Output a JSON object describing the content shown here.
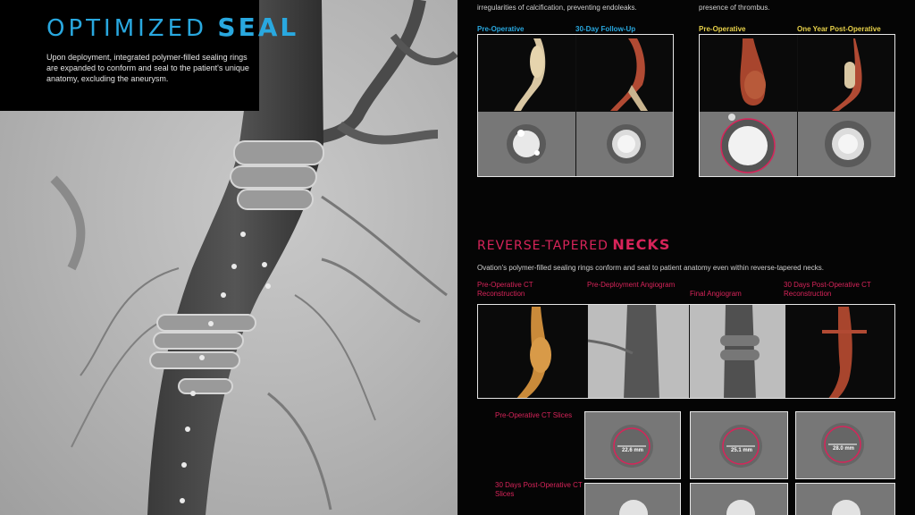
{
  "left_panel": {
    "title_thin": "OPTIMIZED",
    "title_bold": "SEAL",
    "description": "Upon deployment, integrated polymer-filled sealing rings are expanded to conform and seal to the patient's unique anatomy, excluding the aneurysm."
  },
  "top_section": {
    "left_note": "irregularities of calcification, preventing endoleaks.",
    "right_note": "presence of thrombus.",
    "case1": {
      "label_pre": "Pre-Operative",
      "label_post": "30-Day Follow-Up"
    },
    "case2": {
      "label_pre": "Pre-Operative",
      "label_post": "One Year Post-Operative"
    }
  },
  "reverse_section": {
    "title_thin": "REVERSE-TAPERED",
    "title_bold": "NECKS",
    "description": "Ovation's polymer-filled sealing rings conform and seal to patient anatomy even within reverse-tapered necks.",
    "labels": {
      "pre_ct": "Pre-Operative CT Reconstruction",
      "pre_angio": "Pre-Deployment Angiogram",
      "final_angio": "Final Angiogram",
      "post_ct": "30 Days Post-Operative CT Reconstruction"
    },
    "slices_pre_label": "Pre-Operative CT Slices",
    "slices_post_label": "30 Days Post-Operative CT Slices",
    "measurements": [
      "22.6 mm",
      "25.1 mm",
      "28.0 mm"
    ]
  },
  "colors": {
    "accent_blue": "#29a8df",
    "accent_red": "#d8245a",
    "accent_yellow": "#e8d24a"
  }
}
